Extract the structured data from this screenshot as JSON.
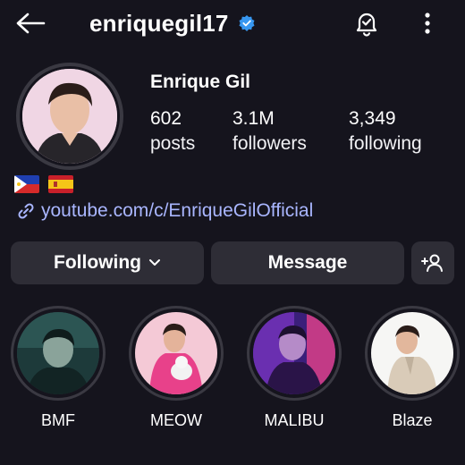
{
  "header": {
    "username": "enriquegil17",
    "verified": true,
    "icons": [
      "back-arrow-icon",
      "verified-badge-icon",
      "notification-bell-icon",
      "more-options-icon"
    ]
  },
  "profile": {
    "display_name": "Enrique Gil",
    "stats": [
      {
        "value": "602",
        "label": "posts"
      },
      {
        "value": "3.1M",
        "label": "followers"
      },
      {
        "value": "3,349",
        "label": "following"
      }
    ],
    "flags": [
      "philippines-flag-icon",
      "spain-flag-icon"
    ],
    "link": "youtube.com/c/EnriqueGilOfficial"
  },
  "actions": {
    "following_label": "Following",
    "message_label": "Message",
    "add_person_icon": "add-person-icon"
  },
  "highlights": [
    {
      "label": "BMF"
    },
    {
      "label": "MEOW"
    },
    {
      "label": "MALIBU"
    },
    {
      "label": "Blaze"
    }
  ],
  "colors": {
    "background": "#15141d",
    "button": "#2e2d36",
    "link": "#a9b6ff",
    "verified": "#3797f0"
  }
}
